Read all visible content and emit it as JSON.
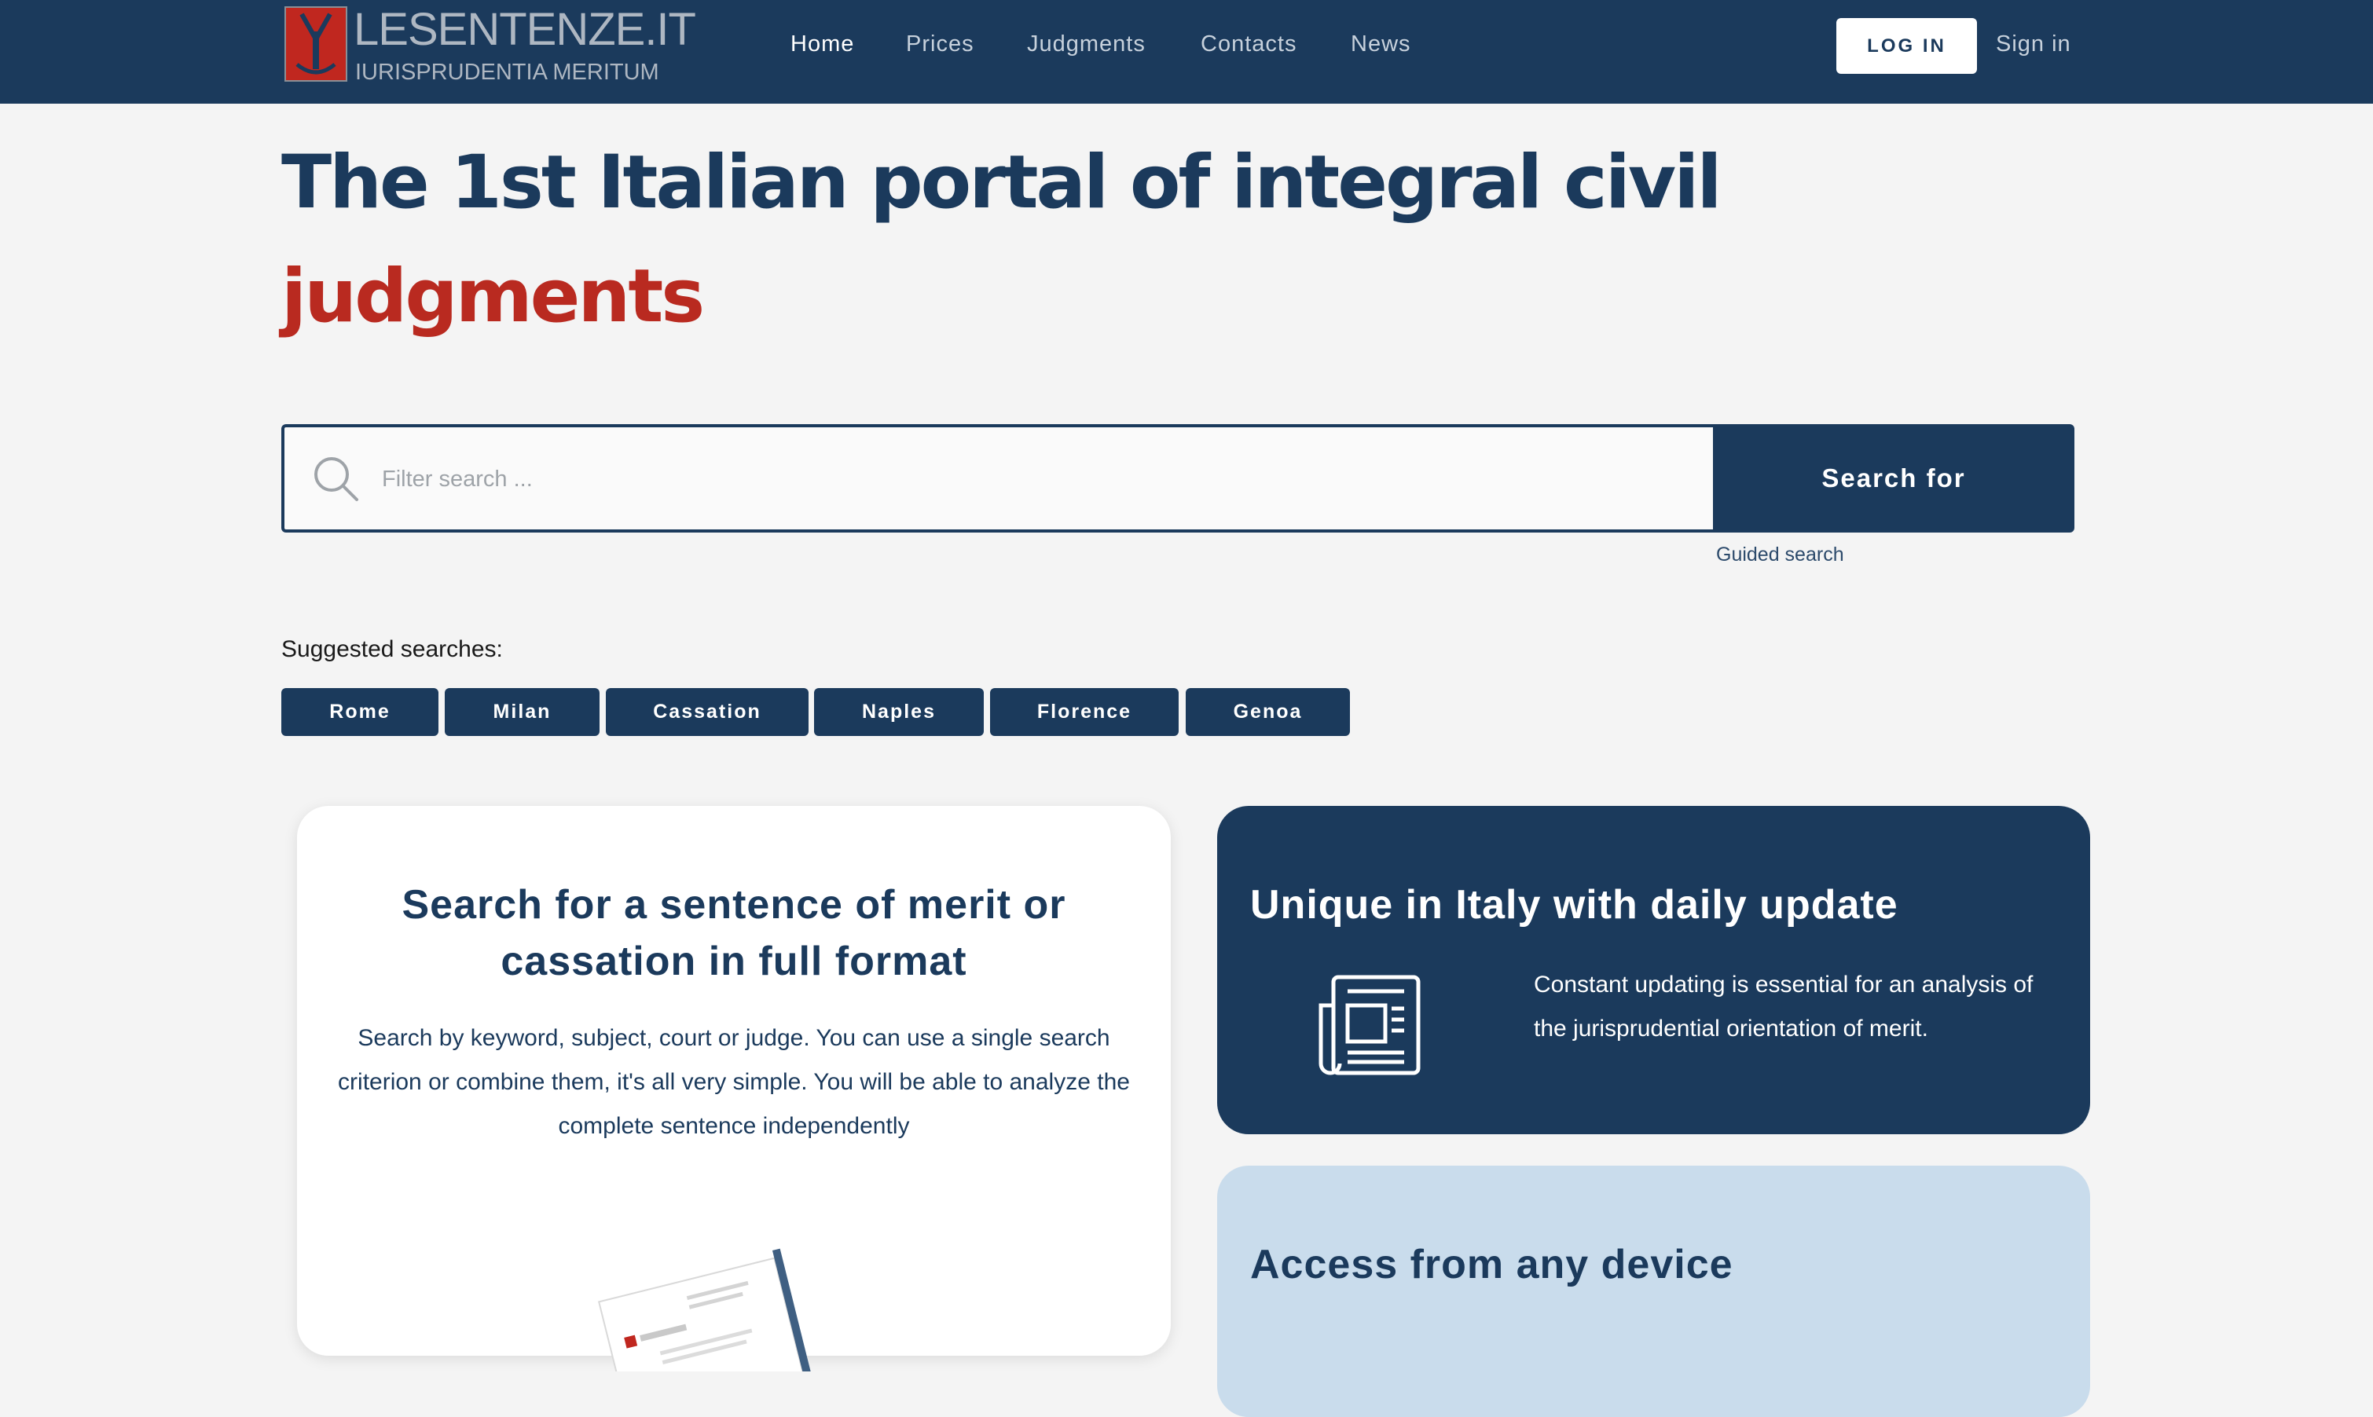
{
  "header": {
    "logo_title": "LESENTENZE.IT",
    "logo_subtitle": "IURISPRUDENTIA MERITUM",
    "nav": [
      {
        "label": "Home",
        "active": true
      },
      {
        "label": "Prices",
        "active": false
      },
      {
        "label": "Judgments",
        "active": false
      },
      {
        "label": "Contacts",
        "active": false
      },
      {
        "label": "News",
        "active": false
      }
    ],
    "login_label": "LOG IN",
    "signin_label": "Sign in"
  },
  "hero": {
    "headline_line1": "The 1st Italian portal of integral civil",
    "headline_line2": "judgments"
  },
  "search": {
    "placeholder": "Filter search ...",
    "value": "",
    "button_label": "Search for",
    "guided_label": "Guided search"
  },
  "suggested": {
    "label": "Suggested searches:",
    "chips": [
      "Rome",
      "Milan",
      "Cassation",
      "Naples",
      "Florence",
      "Genoa"
    ]
  },
  "cards": {
    "search_card": {
      "title": "Search for a sentence of merit or cassation in full format",
      "text": "Search by keyword, subject, court or judge. You can use a single search criterion or combine them, it's all very simple. You will be able to analyze the complete sentence independently"
    },
    "update_card": {
      "title": "Unique in Italy with daily update",
      "text": "Constant updating is essential for an analysis of the jurisprudential orientation of merit.",
      "icon": "newspaper-icon"
    },
    "device_card": {
      "title": "Access from any device"
    }
  },
  "colors": {
    "primary": "#1b3a5c",
    "accent_red": "#b92a20",
    "background": "#f4f4f4",
    "light_card": "#c9dcec"
  }
}
